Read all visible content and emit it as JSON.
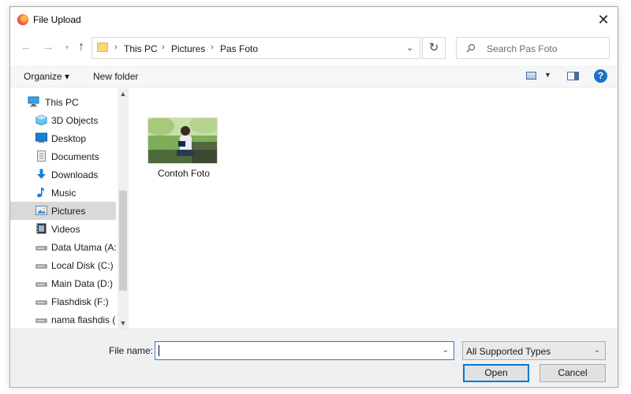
{
  "window": {
    "title": "File Upload",
    "close_glyph": "✕"
  },
  "nav": {
    "back_glyph": "←",
    "forward_glyph": "→",
    "recent_glyph": "▾",
    "up_glyph": "↑"
  },
  "address": {
    "crumbs": [
      "This PC",
      "Pictures",
      "Pas Foto"
    ],
    "sep_glyph": "›",
    "dropdown_glyph": "⌄",
    "refresh_glyph": "↻"
  },
  "search": {
    "placeholder": "Search Pas Foto"
  },
  "toolbar": {
    "organize": "Organize ▾",
    "new_folder": "New folder",
    "view_dropdown_glyph": "▼",
    "help_glyph": "?"
  },
  "sidebar": {
    "items": [
      {
        "label": "This PC",
        "icon": "this-pc-icon"
      },
      {
        "label": "3D Objects",
        "icon": "3d-objects-icon"
      },
      {
        "label": "Desktop",
        "icon": "desktop-icon"
      },
      {
        "label": "Documents",
        "icon": "documents-icon"
      },
      {
        "label": "Downloads",
        "icon": "downloads-icon"
      },
      {
        "label": "Music",
        "icon": "music-icon"
      },
      {
        "label": "Pictures",
        "icon": "pictures-icon"
      },
      {
        "label": "Videos",
        "icon": "videos-icon"
      },
      {
        "label": "Data Utama (A:)",
        "icon": "drive-icon"
      },
      {
        "label": "Local Disk (C:)",
        "icon": "drive-icon"
      },
      {
        "label": "Main Data (D:)",
        "icon": "drive-icon"
      },
      {
        "label": "Flashdisk (F:)",
        "icon": "drive-icon"
      },
      {
        "label": "nama flashdis (G",
        "icon": "drive-icon"
      }
    ],
    "scroll_up_glyph": "▲",
    "scroll_down_glyph": "▼"
  },
  "files": [
    {
      "name": "Contoh Foto",
      "icon": "photo-thumbnail"
    }
  ],
  "bottom": {
    "file_name_label": "File name:",
    "file_name_value": "",
    "file_name_dropdown_glyph": "⌄",
    "file_type": "All Supported Types",
    "file_type_dropdown_glyph": "⌄",
    "open_label": "Open",
    "cancel_label": "Cancel"
  },
  "colors": {
    "accent": "#0078d7",
    "selection": "#d9d9d9",
    "toolbar_bg": "#f5f6f7",
    "bottom_bg": "#f0f0f0"
  }
}
